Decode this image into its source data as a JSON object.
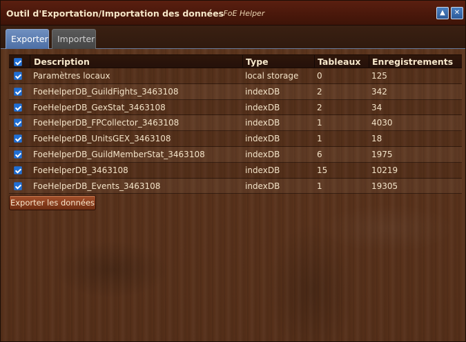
{
  "window": {
    "title": "Outil d'Exportation/Importation des données",
    "subtitle": "- FoE Helper",
    "minimize_icon": "▲",
    "close_icon": "✕"
  },
  "tabs": [
    {
      "label": "Exporter",
      "active": true
    },
    {
      "label": "Importer",
      "active": false
    }
  ],
  "table": {
    "columns": [
      "Description",
      "Type",
      "Tableaux",
      "Enregistrements"
    ],
    "rows": [
      {
        "checked": true,
        "description": "Paramètres locaux",
        "type": "local storage",
        "tableaux": "0",
        "enregistrements": "125"
      },
      {
        "checked": true,
        "description": "FoeHelperDB_GuildFights_3463108",
        "type": "indexDB",
        "tableaux": "2",
        "enregistrements": "342"
      },
      {
        "checked": true,
        "description": "FoeHelperDB_GexStat_3463108",
        "type": "indexDB",
        "tableaux": "2",
        "enregistrements": "34"
      },
      {
        "checked": true,
        "description": "FoeHelperDB_FPCollector_3463108",
        "type": "indexDB",
        "tableaux": "1",
        "enregistrements": "4030"
      },
      {
        "checked": true,
        "description": "FoeHelperDB_UnitsGEX_3463108",
        "type": "indexDB",
        "tableaux": "1",
        "enregistrements": "18"
      },
      {
        "checked": true,
        "description": "FoeHelperDB_GuildMemberStat_3463108",
        "type": "indexDB",
        "tableaux": "6",
        "enregistrements": "1975"
      },
      {
        "checked": true,
        "description": "FoeHelperDB_3463108",
        "type": "indexDB",
        "tableaux": "15",
        "enregistrements": "10219"
      },
      {
        "checked": true,
        "description": "FoeHelperDB_Events_3463108",
        "type": "indexDB",
        "tableaux": "1",
        "enregistrements": "19305"
      }
    ]
  },
  "actions": {
    "export_label": "Exporter les données"
  },
  "colors": {
    "title_bar": "#4a180b",
    "tab_active": "#5b7db4",
    "tab_inactive": "#4e4e4e",
    "button": "#8f4220",
    "checkbox": "#1f6fd6"
  }
}
